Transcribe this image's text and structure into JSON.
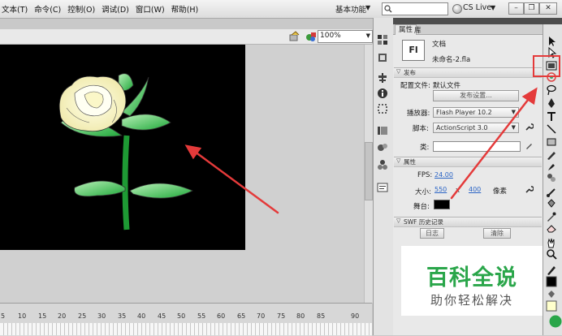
{
  "menu": {
    "items": [
      "文本(T)",
      "命令(C)",
      "控制(O)",
      "调试(D)",
      "窗口(W)",
      "帮助(H)"
    ],
    "workspace": "基本功能",
    "cs_live": "CS Live"
  },
  "editbar": {
    "zoom": "100%"
  },
  "timeline": {
    "ticks": [
      "5",
      "10",
      "15",
      "20",
      "25",
      "30",
      "35",
      "40",
      "45",
      "50",
      "55",
      "60",
      "65",
      "70",
      "75",
      "80",
      "85",
      "90"
    ]
  },
  "panel": {
    "tab_properties": "属性",
    "tab_library": "库",
    "doc_type": "文档",
    "doc_icon": "Fl",
    "file_name": "未命名-2.fla",
    "publish": {
      "section": "发布",
      "profile_label": "配置文件:",
      "profile_value": "默认文件",
      "settings_button": "发布设置...",
      "player_label": "播放器:",
      "player_value": "Flash Player 10.2",
      "script_label": "脚本:",
      "script_value": "ActionScript 3.0",
      "class_label": "类:",
      "class_value": ""
    },
    "properties": {
      "section": "属性",
      "fps_label": "FPS:",
      "fps_value": "24.00",
      "size_label": "大小:",
      "width": "550",
      "x": "x",
      "height": "400",
      "unit": "像素",
      "stage_label": "舞台:",
      "stage_color": "#000000"
    },
    "swf": {
      "section": "SWF 历史记录",
      "log_button": "日志",
      "clear_button": "清除"
    }
  },
  "watermark": {
    "title": "百科全说",
    "subtitle": "助你轻松解决"
  },
  "colors": {
    "highlight": "#e43a3a",
    "link": "#2a64c5",
    "watermark_green": "#2aa64a"
  }
}
